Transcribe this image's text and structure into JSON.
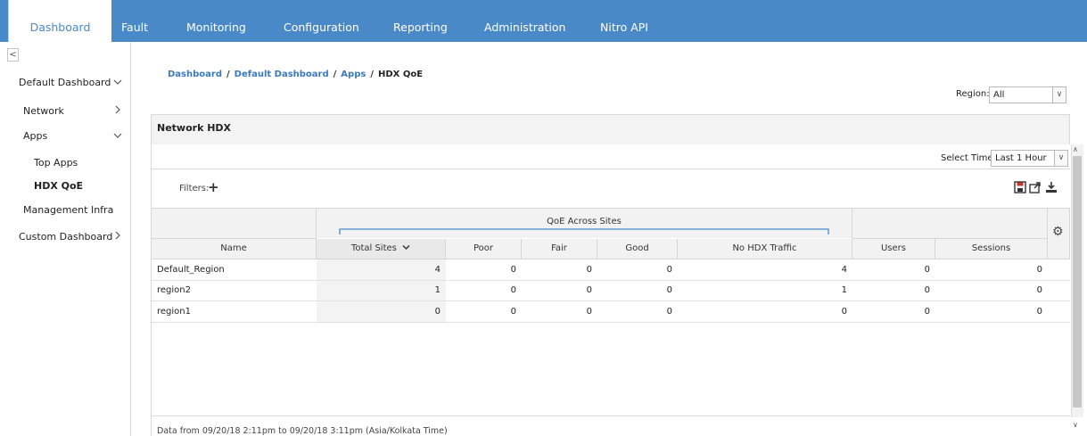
{
  "nav": {
    "tabs": [
      "Dashboard",
      "Fault",
      "Monitoring",
      "Configuration",
      "Reporting",
      "Administration",
      "Nitro API"
    ],
    "active": "Dashboard"
  },
  "sidebar": {
    "collapse_glyph": "<",
    "items": [
      {
        "label": "Default Dashboard",
        "chevron": "down"
      },
      {
        "label": "Network",
        "chevron": "right"
      },
      {
        "label": "Apps",
        "chevron": "down"
      },
      {
        "label": "Top Apps"
      },
      {
        "label": "HDX QoE",
        "selected": true
      },
      {
        "label": "Management Infra"
      },
      {
        "label": "Custom Dashboard",
        "chevron": "right"
      }
    ]
  },
  "breadcrumb": {
    "items": [
      "Dashboard",
      "Default Dashboard",
      "Apps",
      "HDX QoE"
    ],
    "separator": "/"
  },
  "region": {
    "label": "Region:",
    "value": "All"
  },
  "panel": {
    "title": "Network HDX",
    "select_time_label": "Select Time:",
    "select_time_value": "Last 1 Hour",
    "filters_label": "Filters:",
    "filters_add": "+"
  },
  "table": {
    "group_header": "QoE Across Sites",
    "columns": [
      "Name",
      "Total Sites",
      "Poor",
      "Fair",
      "Good",
      "No HDX Traffic",
      "Users",
      "Sessions"
    ],
    "sort_column": "Total Sites",
    "sort_icon": "chevron-down-icon",
    "rows": [
      [
        "Default_Region",
        "4",
        "0",
        "0",
        "0",
        "4",
        "0",
        "0"
      ],
      [
        "region2",
        "1",
        "0",
        "0",
        "0",
        "1",
        "0",
        "0"
      ],
      [
        "region1",
        "0",
        "0",
        "0",
        "0",
        "0",
        "0",
        "0"
      ]
    ]
  },
  "footnote": "Data from 09/20/18 2:11pm to 09/20/18 3:11pm (Asia/Kolkata Time)",
  "colors": {
    "nav_bg": "#4a89c8",
    "link": "#3a7abf",
    "group_bracket": "#4a89c8"
  },
  "icons": {
    "toolbar": [
      "save-icon",
      "export-icon",
      "download-icon"
    ],
    "settings": "gear-icon"
  }
}
